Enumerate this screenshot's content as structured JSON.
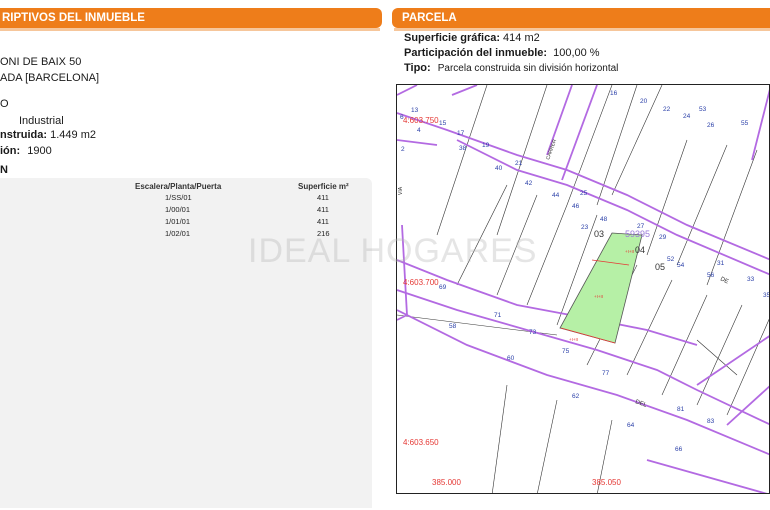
{
  "left_panel": {
    "header_title": "RIPTIVOS DEL INMUEBLE",
    "address_line1": "ONI DE BAIX 50",
    "address_line2": "ADA [BARCELONA]",
    "section_letter": "O",
    "use_value": "Industrial",
    "built_area_label": "nstruida:",
    "built_area_value": "1.449 m2",
    "year_label": "ión:",
    "year_value": "1900",
    "section_n": "N",
    "table": {
      "headers": [
        "Escalera/Planta/Puerta",
        "Superficie m²"
      ],
      "rows": [
        [
          "1/SS/01",
          "411"
        ],
        [
          "1/00/01",
          "411"
        ],
        [
          "1/01/01",
          "411"
        ],
        [
          "1/02/01",
          "216"
        ]
      ]
    }
  },
  "right_panel": {
    "header_title": "PARCELA",
    "surface_label": "Superficie gráfica:",
    "surface_value": "414 m2",
    "participation_label": "Participación del inmueble:",
    "participation_value": "100,00 %",
    "type_label": "Tipo:",
    "type_value": "Parcela construida sin división horizontal"
  },
  "map": {
    "coord_labels": [
      "4:603.750",
      "4:603.700",
      "4:603.650",
      "385.000",
      "385.050"
    ],
    "parcel_labels": [
      "03",
      "04",
      "05",
      "59395"
    ],
    "street_labels": [
      "CARRER",
      "DEL",
      "DE",
      "VIA"
    ],
    "road_numbers_top": [
      "13",
      "15",
      "17",
      "19",
      "21",
      "38",
      "40",
      "42",
      "44",
      "46",
      "48",
      "25",
      "27",
      "29",
      "31",
      "33",
      "35",
      "16",
      "20",
      "22",
      "24",
      "26",
      "53",
      "55",
      "2",
      "4",
      "6",
      "23"
    ],
    "road_numbers_bottom": [
      "69",
      "71",
      "73",
      "75",
      "77",
      "58",
      "60",
      "62",
      "64",
      "66",
      "81",
      "83",
      "52",
      "54",
      "56"
    ],
    "height_labels": [
      "+I+II",
      "+I+II",
      "+I+II"
    ]
  },
  "watermark": "IDEAL HOGARES",
  "colors": {
    "header": "#ee7d1a",
    "road": "#b36ae2",
    "parcel_fill": "#b6f0a6",
    "coord_red": "#e53935",
    "road_number_blue": "#2a3fa8"
  }
}
